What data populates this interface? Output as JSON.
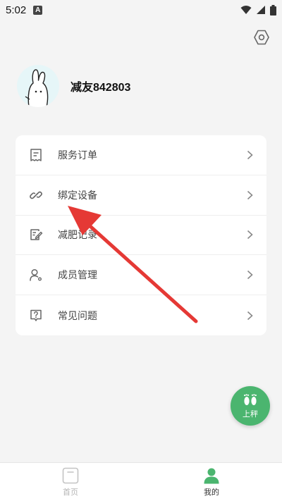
{
  "status_bar": {
    "time": "5:02",
    "notification_glyph": "A",
    "icons": [
      "wifi-icon",
      "signal-icon",
      "battery-icon"
    ]
  },
  "profile": {
    "username": "减友842803"
  },
  "menu": {
    "items": [
      {
        "label": "服务订单",
        "icon": "receipt-icon"
      },
      {
        "label": "绑定设备",
        "icon": "link-icon"
      },
      {
        "label": "减肥记录",
        "icon": "edit-note-icon"
      },
      {
        "label": "成员管理",
        "icon": "member-icon"
      },
      {
        "label": "常见问题",
        "icon": "help-icon"
      }
    ]
  },
  "fab": {
    "label": "上秤",
    "icon": "footprints-icon"
  },
  "tabs": [
    {
      "label": "首页",
      "icon": "home-icon",
      "active": false
    },
    {
      "label": "我的",
      "icon": "person-icon",
      "active": true
    }
  ],
  "colors": {
    "accent": "#4bb56f",
    "annotation_arrow": "#e53935",
    "background": "#f4f4f4"
  }
}
